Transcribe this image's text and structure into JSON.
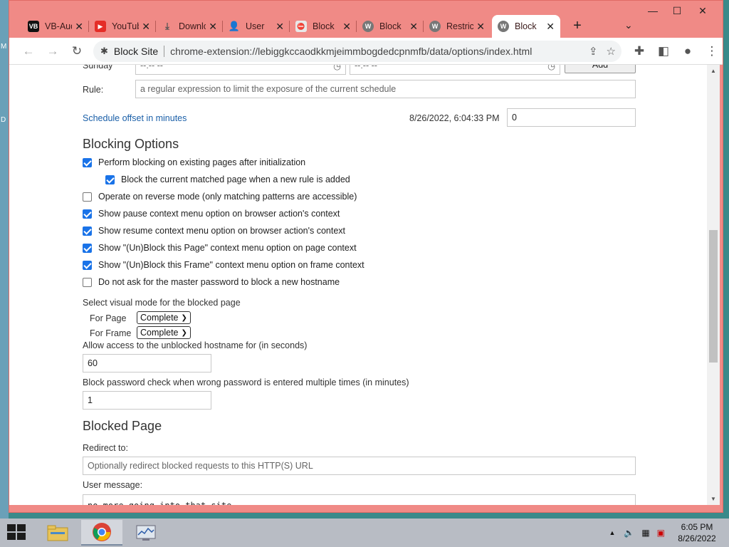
{
  "colors": {
    "accent": "#1a73e8",
    "tab_strip": "#f08a86",
    "link": "#1a5fa8"
  },
  "desktop": {
    "letters": [
      "M",
      "D"
    ]
  },
  "tabs": [
    {
      "title": "VB-Audio",
      "icon": "vb-audio-icon",
      "color": "#111"
    },
    {
      "title": "YouTube",
      "icon": "youtube-icon",
      "color": "#e52d27"
    },
    {
      "title": "Download",
      "icon": "download-icon",
      "color": "#555"
    },
    {
      "title": "User",
      "icon": "user-icon",
      "color": "#555"
    },
    {
      "title": "Block",
      "icon": "blocksite-icon",
      "color": "#d26a3a"
    },
    {
      "title": "Block",
      "icon": "w-icon",
      "color": "#777"
    },
    {
      "title": "Restrict",
      "icon": "w-icon",
      "color": "#777"
    },
    {
      "title": "Block",
      "icon": "w-icon",
      "color": "#777",
      "active": true
    }
  ],
  "omnibox": {
    "site": "Block Site",
    "url": "chrome-extension://lebiggkccaodkkmjeimmbogdedcpnmfb/data/options/index.html"
  },
  "schedule": {
    "day_label": "Sunday",
    "start_time": "--:-- --",
    "end_time": "--:-- --",
    "add_label": "Add",
    "rule_label": "Rule:",
    "rule_placeholder": "a regular expression to limit the exposure of the current schedule",
    "offset_label": "Schedule offset in minutes",
    "timestamp": "8/26/2022, 6:04:33 PM",
    "offset_value": "0"
  },
  "blocking": {
    "title": "Blocking Options",
    "options": [
      {
        "label": "Perform blocking on existing pages after initialization",
        "checked": true,
        "indent": false
      },
      {
        "label": "Block the current matched page when a new rule is added",
        "checked": true,
        "indent": true
      },
      {
        "label": "Operate on reverse mode (only matching patterns are accessible)",
        "checked": false,
        "indent": false
      },
      {
        "label": "Show pause context menu option on browser action's context",
        "checked": true,
        "indent": false
      },
      {
        "label": "Show resume context menu option on browser action's context",
        "checked": true,
        "indent": false
      },
      {
        "label": "Show \"(Un)Block this Page\" context menu option on page context",
        "checked": true,
        "indent": false
      },
      {
        "label": "Show \"(Un)Block this Frame\" context menu option on frame context",
        "checked": true,
        "indent": false
      },
      {
        "label": "Do not ask for the master password to block a new hostname",
        "checked": false,
        "indent": false
      }
    ],
    "visual_mode_label": "Select visual mode for the blocked page",
    "for_page_label": "For Page",
    "for_page_value": "Complete",
    "for_frame_label": "For Frame",
    "for_frame_value": "Complete",
    "allow_access_label": "Allow access to the unblocked hostname for (in seconds)",
    "allow_access_value": "60",
    "password_check_label": "Block password check when wrong password is entered multiple times (in minutes)",
    "password_check_value": "1"
  },
  "blocked_page": {
    "title": "Blocked Page",
    "redirect_label": "Redirect to:",
    "redirect_placeholder": "Optionally redirect blocked requests to this HTTP(S) URL",
    "user_message_label": "User message:",
    "user_message_value": "no more going into that site"
  },
  "taskbar": {
    "time": "6:05 PM",
    "date": "8/26/2022"
  }
}
